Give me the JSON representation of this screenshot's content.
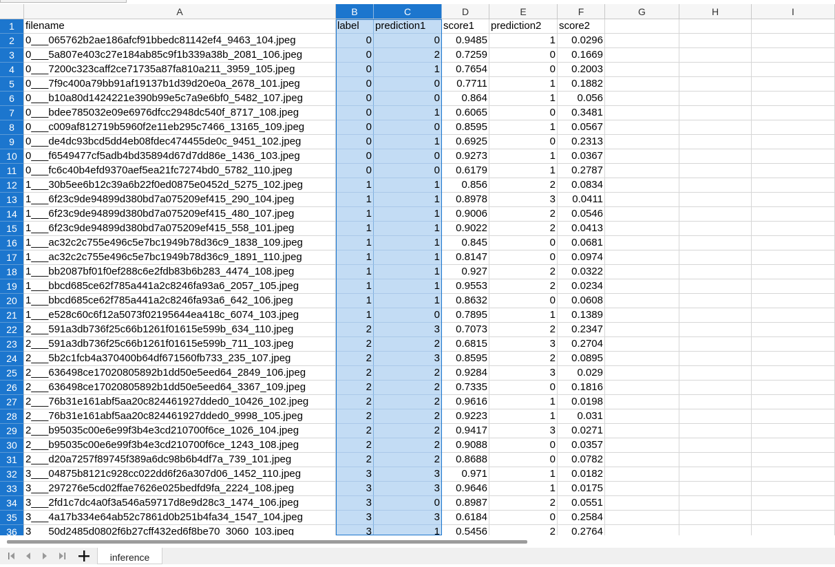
{
  "columns": [
    {
      "letter": "A",
      "selected": false
    },
    {
      "letter": "B",
      "selected": true
    },
    {
      "letter": "C",
      "selected": true
    },
    {
      "letter": "D",
      "selected": false
    },
    {
      "letter": "E",
      "selected": false
    },
    {
      "letter": "F",
      "selected": false
    },
    {
      "letter": "G",
      "selected": false
    },
    {
      "letter": "H",
      "selected": false
    },
    {
      "letter": "I",
      "selected": false
    }
  ],
  "header_row": {
    "num": "1",
    "cells": [
      "filename",
      "label",
      "prediction1",
      "score1",
      "prediction2",
      "score2"
    ]
  },
  "rows": [
    {
      "num": "2",
      "cells": [
        "0___065762b2ae186afcf91bbedc81142ef4_9463_104.jpeg",
        "0",
        "0",
        "0.9485",
        "1",
        "0.0296"
      ]
    },
    {
      "num": "3",
      "cells": [
        "0___5a807e403c27e184ab85c9f1b339a38b_2081_106.jpeg",
        "0",
        "2",
        "0.7259",
        "0",
        "0.1669"
      ]
    },
    {
      "num": "4",
      "cells": [
        "0___7200c323caff2ce71735a87fa810a211_3959_105.jpeg",
        "0",
        "1",
        "0.7654",
        "0",
        "0.2003"
      ]
    },
    {
      "num": "5",
      "cells": [
        "0___7f9c400a79bb91af19137b1d39d20e0a_2678_101.jpeg",
        "0",
        "0",
        "0.7711",
        "1",
        "0.1882"
      ]
    },
    {
      "num": "6",
      "cells": [
        "0___b10a80d1424221e390b99e5c7a9e6bf0_5482_107.jpeg",
        "0",
        "0",
        "0.864",
        "1",
        "0.056"
      ]
    },
    {
      "num": "7",
      "cells": [
        "0___bdee785032e09e6976dfcc2948dc540f_8717_108.jpeg",
        "0",
        "1",
        "0.6065",
        "0",
        "0.3481"
      ]
    },
    {
      "num": "8",
      "cells": [
        "0___c009af812719b5960f2e11eb295c7466_13165_109.jpeg",
        "0",
        "0",
        "0.8595",
        "1",
        "0.0567"
      ]
    },
    {
      "num": "9",
      "cells": [
        "0___de4dc93bcd5dd4eb08fdec474455de0c_9451_102.jpeg",
        "0",
        "1",
        "0.6925",
        "0",
        "0.2313"
      ]
    },
    {
      "num": "10",
      "cells": [
        "0___f6549477cf5adb4bd35894d67d7dd86e_1436_103.jpeg",
        "0",
        "0",
        "0.9273",
        "1",
        "0.0367"
      ]
    },
    {
      "num": "11",
      "cells": [
        "0___fc6c40b4efd9370aef5ea21fc7274bd0_5782_110.jpeg",
        "0",
        "0",
        "0.6179",
        "1",
        "0.2787"
      ]
    },
    {
      "num": "12",
      "cells": [
        "1___30b5ee6b12c39a6b22f0ed0875e0452d_5275_102.jpeg",
        "1",
        "1",
        "0.856",
        "2",
        "0.0834"
      ]
    },
    {
      "num": "13",
      "cells": [
        "1___6f23c9de94899d380bd7a075209ef415_290_104.jpeg",
        "1",
        "1",
        "0.8978",
        "3",
        "0.0411"
      ]
    },
    {
      "num": "14",
      "cells": [
        "1___6f23c9de94899d380bd7a075209ef415_480_107.jpeg",
        "1",
        "1",
        "0.9006",
        "2",
        "0.0546"
      ]
    },
    {
      "num": "15",
      "cells": [
        "1___6f23c9de94899d380bd7a075209ef415_558_101.jpeg",
        "1",
        "1",
        "0.9022",
        "2",
        "0.0413"
      ]
    },
    {
      "num": "16",
      "cells": [
        "1___ac32c2c755e496c5e7bc1949b78d36c9_1838_109.jpeg",
        "1",
        "1",
        "0.845",
        "0",
        "0.0681"
      ]
    },
    {
      "num": "17",
      "cells": [
        "1___ac32c2c755e496c5e7bc1949b78d36c9_1891_110.jpeg",
        "1",
        "1",
        "0.8147",
        "0",
        "0.0974"
      ]
    },
    {
      "num": "18",
      "cells": [
        "1___bb2087bf01f0ef288c6e2fdb83b6b283_4474_108.jpeg",
        "1",
        "1",
        "0.927",
        "2",
        "0.0322"
      ]
    },
    {
      "num": "19",
      "cells": [
        "1___bbcd685ce62f785a441a2c8246fa93a6_2057_105.jpeg",
        "1",
        "1",
        "0.9553",
        "2",
        "0.0234"
      ]
    },
    {
      "num": "20",
      "cells": [
        "1___bbcd685ce62f785a441a2c8246fa93a6_642_106.jpeg",
        "1",
        "1",
        "0.8632",
        "0",
        "0.0608"
      ]
    },
    {
      "num": "21",
      "cells": [
        "1___e528c60c6f12a5073f02195644ea418c_6074_103.jpeg",
        "1",
        "0",
        "0.7895",
        "1",
        "0.1389"
      ]
    },
    {
      "num": "22",
      "cells": [
        "2___591a3db736f25c66b1261f01615e599b_634_110.jpeg",
        "2",
        "3",
        "0.7073",
        "2",
        "0.2347"
      ]
    },
    {
      "num": "23",
      "cells": [
        "2___591a3db736f25c66b1261f01615e599b_711_103.jpeg",
        "2",
        "2",
        "0.6815",
        "3",
        "0.2704"
      ]
    },
    {
      "num": "24",
      "cells": [
        "2___5b2c1fcb4a370400b64df671560fb733_235_107.jpeg",
        "2",
        "3",
        "0.8595",
        "2",
        "0.0895"
      ]
    },
    {
      "num": "25",
      "cells": [
        "2___636498ce17020805892b1dd50e5eed64_2849_106.jpeg",
        "2",
        "2",
        "0.9284",
        "3",
        "0.029"
      ]
    },
    {
      "num": "26",
      "cells": [
        "2___636498ce17020805892b1dd50e5eed64_3367_109.jpeg",
        "2",
        "2",
        "0.7335",
        "0",
        "0.1816"
      ]
    },
    {
      "num": "27",
      "cells": [
        "2___76b31e161abf5aa20c824461927dded0_10426_102.jpeg",
        "2",
        "2",
        "0.9616",
        "1",
        "0.0198"
      ]
    },
    {
      "num": "28",
      "cells": [
        "2___76b31e161abf5aa20c824461927dded0_9998_105.jpeg",
        "2",
        "2",
        "0.9223",
        "1",
        "0.031"
      ]
    },
    {
      "num": "29",
      "cells": [
        "2___b95035c00e6e99f3b4e3cd210700f6ce_1026_104.jpeg",
        "2",
        "2",
        "0.9417",
        "3",
        "0.0271"
      ]
    },
    {
      "num": "30",
      "cells": [
        "2___b95035c00e6e99f3b4e3cd210700f6ce_1243_108.jpeg",
        "2",
        "2",
        "0.9088",
        "0",
        "0.0357"
      ]
    },
    {
      "num": "31",
      "cells": [
        "2___d20a7257f89745f389a6dc98b6b4df7a_739_101.jpeg",
        "2",
        "2",
        "0.8688",
        "0",
        "0.0782"
      ]
    },
    {
      "num": "32",
      "cells": [
        "3___04875b8121c928cc022dd6f26a307d06_1452_110.jpeg",
        "3",
        "3",
        "0.971",
        "1",
        "0.0182"
      ]
    },
    {
      "num": "33",
      "cells": [
        "3___297276e5cd02ffae7626e025bedfd9fa_2224_108.jpeg",
        "3",
        "3",
        "0.9646",
        "1",
        "0.0175"
      ]
    },
    {
      "num": "34",
      "cells": [
        "3___2fd1c7dc4a0f3a546a59717d8e9d28c3_1474_106.jpeg",
        "3",
        "0",
        "0.8987",
        "2",
        "0.0551"
      ]
    },
    {
      "num": "35",
      "cells": [
        "3___4a17b334e64ab52c7861d0b251b4fa34_1547_104.jpeg",
        "3",
        "3",
        "0.6184",
        "0",
        "0.2584"
      ]
    },
    {
      "num": "36",
      "cells": [
        "3___50d2485d0802f6b27cff432ed6f8be70_3060_103.jpeg",
        "3",
        "1",
        "0.5456",
        "2",
        "0.2764"
      ]
    }
  ],
  "sheet_tab": {
    "label": "inference"
  },
  "icons": {
    "first": "first-sheet-icon",
    "prev": "previous-sheet-icon",
    "next": "next-sheet-icon",
    "last": "last-sheet-icon",
    "add": "add-sheet-icon"
  },
  "colors": {
    "selection": "#1c76ce",
    "selection_fill": "#c3dcf4"
  }
}
